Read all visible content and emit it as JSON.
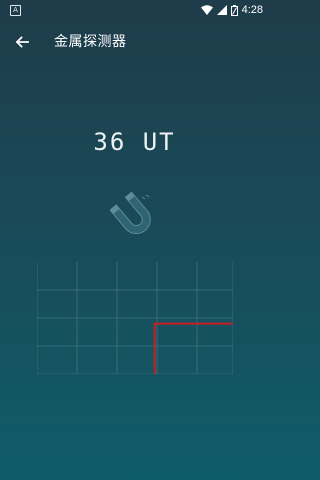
{
  "status_bar": {
    "app_icon_letter": "A",
    "time": "4:28",
    "icons": [
      "wifi-icon",
      "signal-icon",
      "battery-icon"
    ]
  },
  "toolbar": {
    "back_icon": "arrow-left-icon",
    "title": "金属探测器"
  },
  "reading": {
    "value": "36",
    "unit": "UT",
    "display": "36 UT"
  },
  "colors": {
    "background_top": "#1e3c49",
    "background_bottom": "#0f5c69",
    "line": "#c81e23",
    "grid": "#6f8f98"
  },
  "chart_data": {
    "type": "line",
    "x": [
      0,
      1,
      2,
      3,
      4,
      5,
      6,
      7,
      8,
      9,
      10,
      11,
      12,
      13,
      14,
      15,
      16,
      17,
      18,
      19,
      20
    ],
    "values": [
      null,
      null,
      null,
      null,
      null,
      null,
      null,
      null,
      null,
      null,
      null,
      null,
      36,
      36,
      36,
      36,
      36,
      36,
      36,
      36,
      36
    ],
    "ylim": [
      0,
      80
    ],
    "grid": true,
    "title": "",
    "xlabel": "",
    "ylabel": ""
  }
}
